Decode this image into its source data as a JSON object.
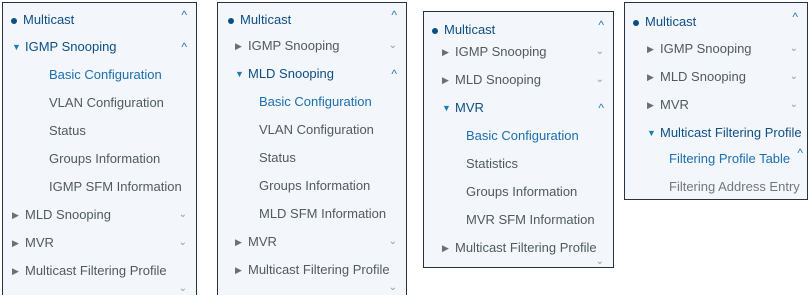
{
  "panel1": {
    "multicast": "Multicast",
    "igmp": "IGMP Snooping",
    "items": [
      "Basic Configuration",
      "VLAN Configuration",
      "Status",
      "Groups Information",
      "IGMP SFM Information"
    ],
    "mld": "MLD Snooping",
    "mvr": "MVR",
    "mfp": "Multicast Filtering Profile"
  },
  "panel2": {
    "multicast": "Multicast",
    "igmp": "IGMP Snooping",
    "mld": "MLD Snooping",
    "items": [
      "Basic Configuration",
      "VLAN Configuration",
      "Status",
      "Groups Information",
      "MLD SFM Information"
    ],
    "mvr": "MVR",
    "mfp": "Multicast Filtering Profile"
  },
  "panel3": {
    "multicast": "Multicast",
    "igmp": "IGMP Snooping",
    "mld": "MLD Snooping",
    "mvr": "MVR",
    "items": [
      "Basic Configuration",
      "Statistics",
      "Groups Information",
      "MVR SFM Information"
    ],
    "mfp": "Multicast Filtering Profile"
  },
  "panel4": {
    "multicast": "Multicast",
    "igmp": "IGMP Snooping",
    "mld": "MLD Snooping",
    "mvr": "MVR",
    "mfp": "Multicast Filtering Profile",
    "items": [
      "Filtering Profile Table",
      "Filtering Address Entry"
    ]
  },
  "icons": {
    "dot": "bullet-dot",
    "expanded": "triangle-down",
    "collapsed": "triangle-right",
    "up": "chevron-up",
    "down": "chevron-down"
  },
  "colors": {
    "panel_bg": "#f3f6fa",
    "border": "#26323c",
    "header": "#0e4f86",
    "active": "#1b6fb0",
    "muted": "#505a63"
  }
}
